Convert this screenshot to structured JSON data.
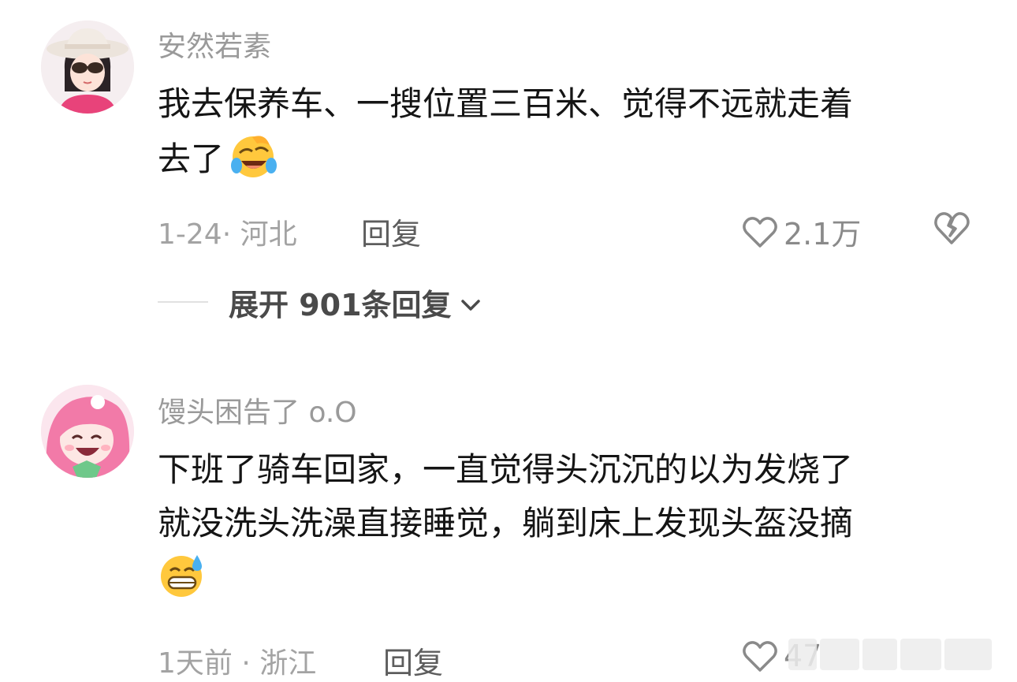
{
  "comments": [
    {
      "username": "安然若素",
      "text_lines": [
        "我去保养车、一搜位置三百米、觉得不远就走着",
        "去了"
      ],
      "emoji": "laugh-cry-emoji",
      "date_location": "1-24· 河北",
      "reply_label": "回复",
      "likes": "2.1万",
      "expand_label": "展开 901条回复"
    },
    {
      "username": "馒头困告了 o.O",
      "text_lines": [
        "下班了骑车回家，一直觉得头沉沉的以为发烧了",
        "就没洗头洗澡直接睡觉，躺到床上发现头盔没摘"
      ],
      "emoji": "grin-sweat-emoji",
      "date_location": "1天前 · 浙江",
      "reply_label": "回复",
      "likes": "47"
    }
  ],
  "colors": {
    "username": "#9a9a9a",
    "text": "#151515",
    "meta": "#a3a3a3",
    "emoji_yellow": "#ffc83d"
  }
}
